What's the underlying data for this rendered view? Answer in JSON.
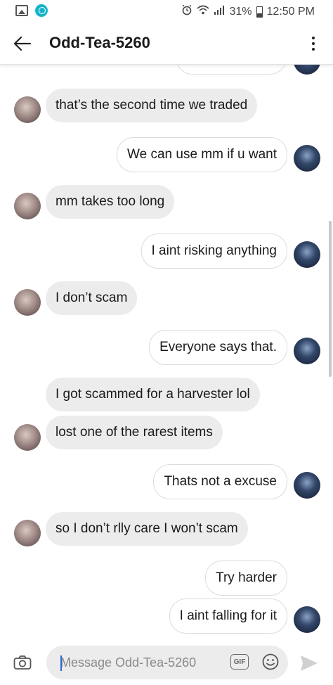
{
  "status_bar": {
    "battery": "31%",
    "time": "12:50 PM"
  },
  "header": {
    "title": "Odd-Tea-5260"
  },
  "messages": [
    {
      "from": "me",
      "text": ""
    },
    {
      "from": "them",
      "text": "that’s the second time we traded"
    },
    {
      "from": "me",
      "text": "We can use mm if u want"
    },
    {
      "from": "them",
      "text": "mm takes too long"
    },
    {
      "from": "me",
      "text": "I aint risking anything"
    },
    {
      "from": "them",
      "text": "I don’t scam"
    },
    {
      "from": "me",
      "text": "Everyone says that."
    },
    {
      "from": "them",
      "text": "I got scammed for a harvester lol"
    },
    {
      "from": "them",
      "text": "lost one of the rarest items"
    },
    {
      "from": "me",
      "text": "Thats not a excuse"
    },
    {
      "from": "them",
      "text": "so I don’t rlly care I won’t scam"
    },
    {
      "from": "me",
      "text": "Try harder"
    },
    {
      "from": "me",
      "text": "I aint falling for it"
    }
  ],
  "composer": {
    "placeholder": "Message Odd-Tea-5260",
    "value": "",
    "gif_label": "GIF"
  },
  "icons": {
    "back": "back-arrow-icon",
    "menu": "more-vert-icon",
    "camera": "camera-icon",
    "emoji": "emoji-icon",
    "send": "send-icon"
  },
  "colors": {
    "incoming_bubble": "#ececec",
    "outgoing_bubble": "#ffffff",
    "outgoing_border": "#dcdcdc",
    "caret": "#2a6bd8"
  }
}
